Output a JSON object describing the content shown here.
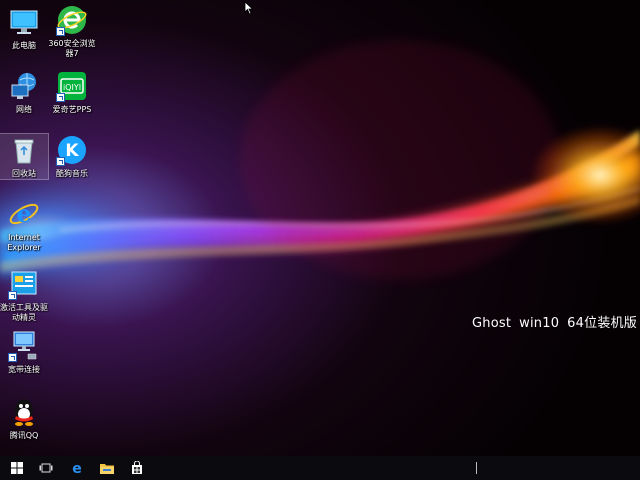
{
  "desktop": {
    "icons": [
      {
        "name": "此电脑",
        "icon": "this-pc-icon"
      },
      {
        "name": "360安全浏览器7",
        "icon": "360-browser-icon"
      },
      {
        "name": "网络",
        "icon": "network-icon"
      },
      {
        "name": "爱奇艺PPS",
        "icon": "iqiyi-pps-icon"
      },
      {
        "name": "回收站",
        "icon": "recycle-bin-icon"
      },
      {
        "name": "酷狗音乐",
        "icon": "kugou-music-icon"
      },
      {
        "name": "Internet Explorer",
        "icon": "internet-explorer-icon"
      },
      {
        "name": "激活工具及驱动精灵",
        "icon": "activation-tools-icon"
      },
      {
        "name": "宽带连接",
        "icon": "broadband-connection-icon"
      },
      {
        "name": "腾讯QQ",
        "icon": "tencent-qq-icon"
      }
    ],
    "watermark": {
      "part1": "Ghost",
      "part2": "win10",
      "part3": "64位装机版"
    }
  },
  "taskbar": {
    "buttons": [
      "start-icon",
      "task-view-icon",
      "edge-icon",
      "file-explorer-icon",
      "store-icon"
    ]
  },
  "colors": {
    "taskbar": "#0b0b0f",
    "accent_blue": "#1e90ff",
    "watermark_text": "#ffffff"
  }
}
